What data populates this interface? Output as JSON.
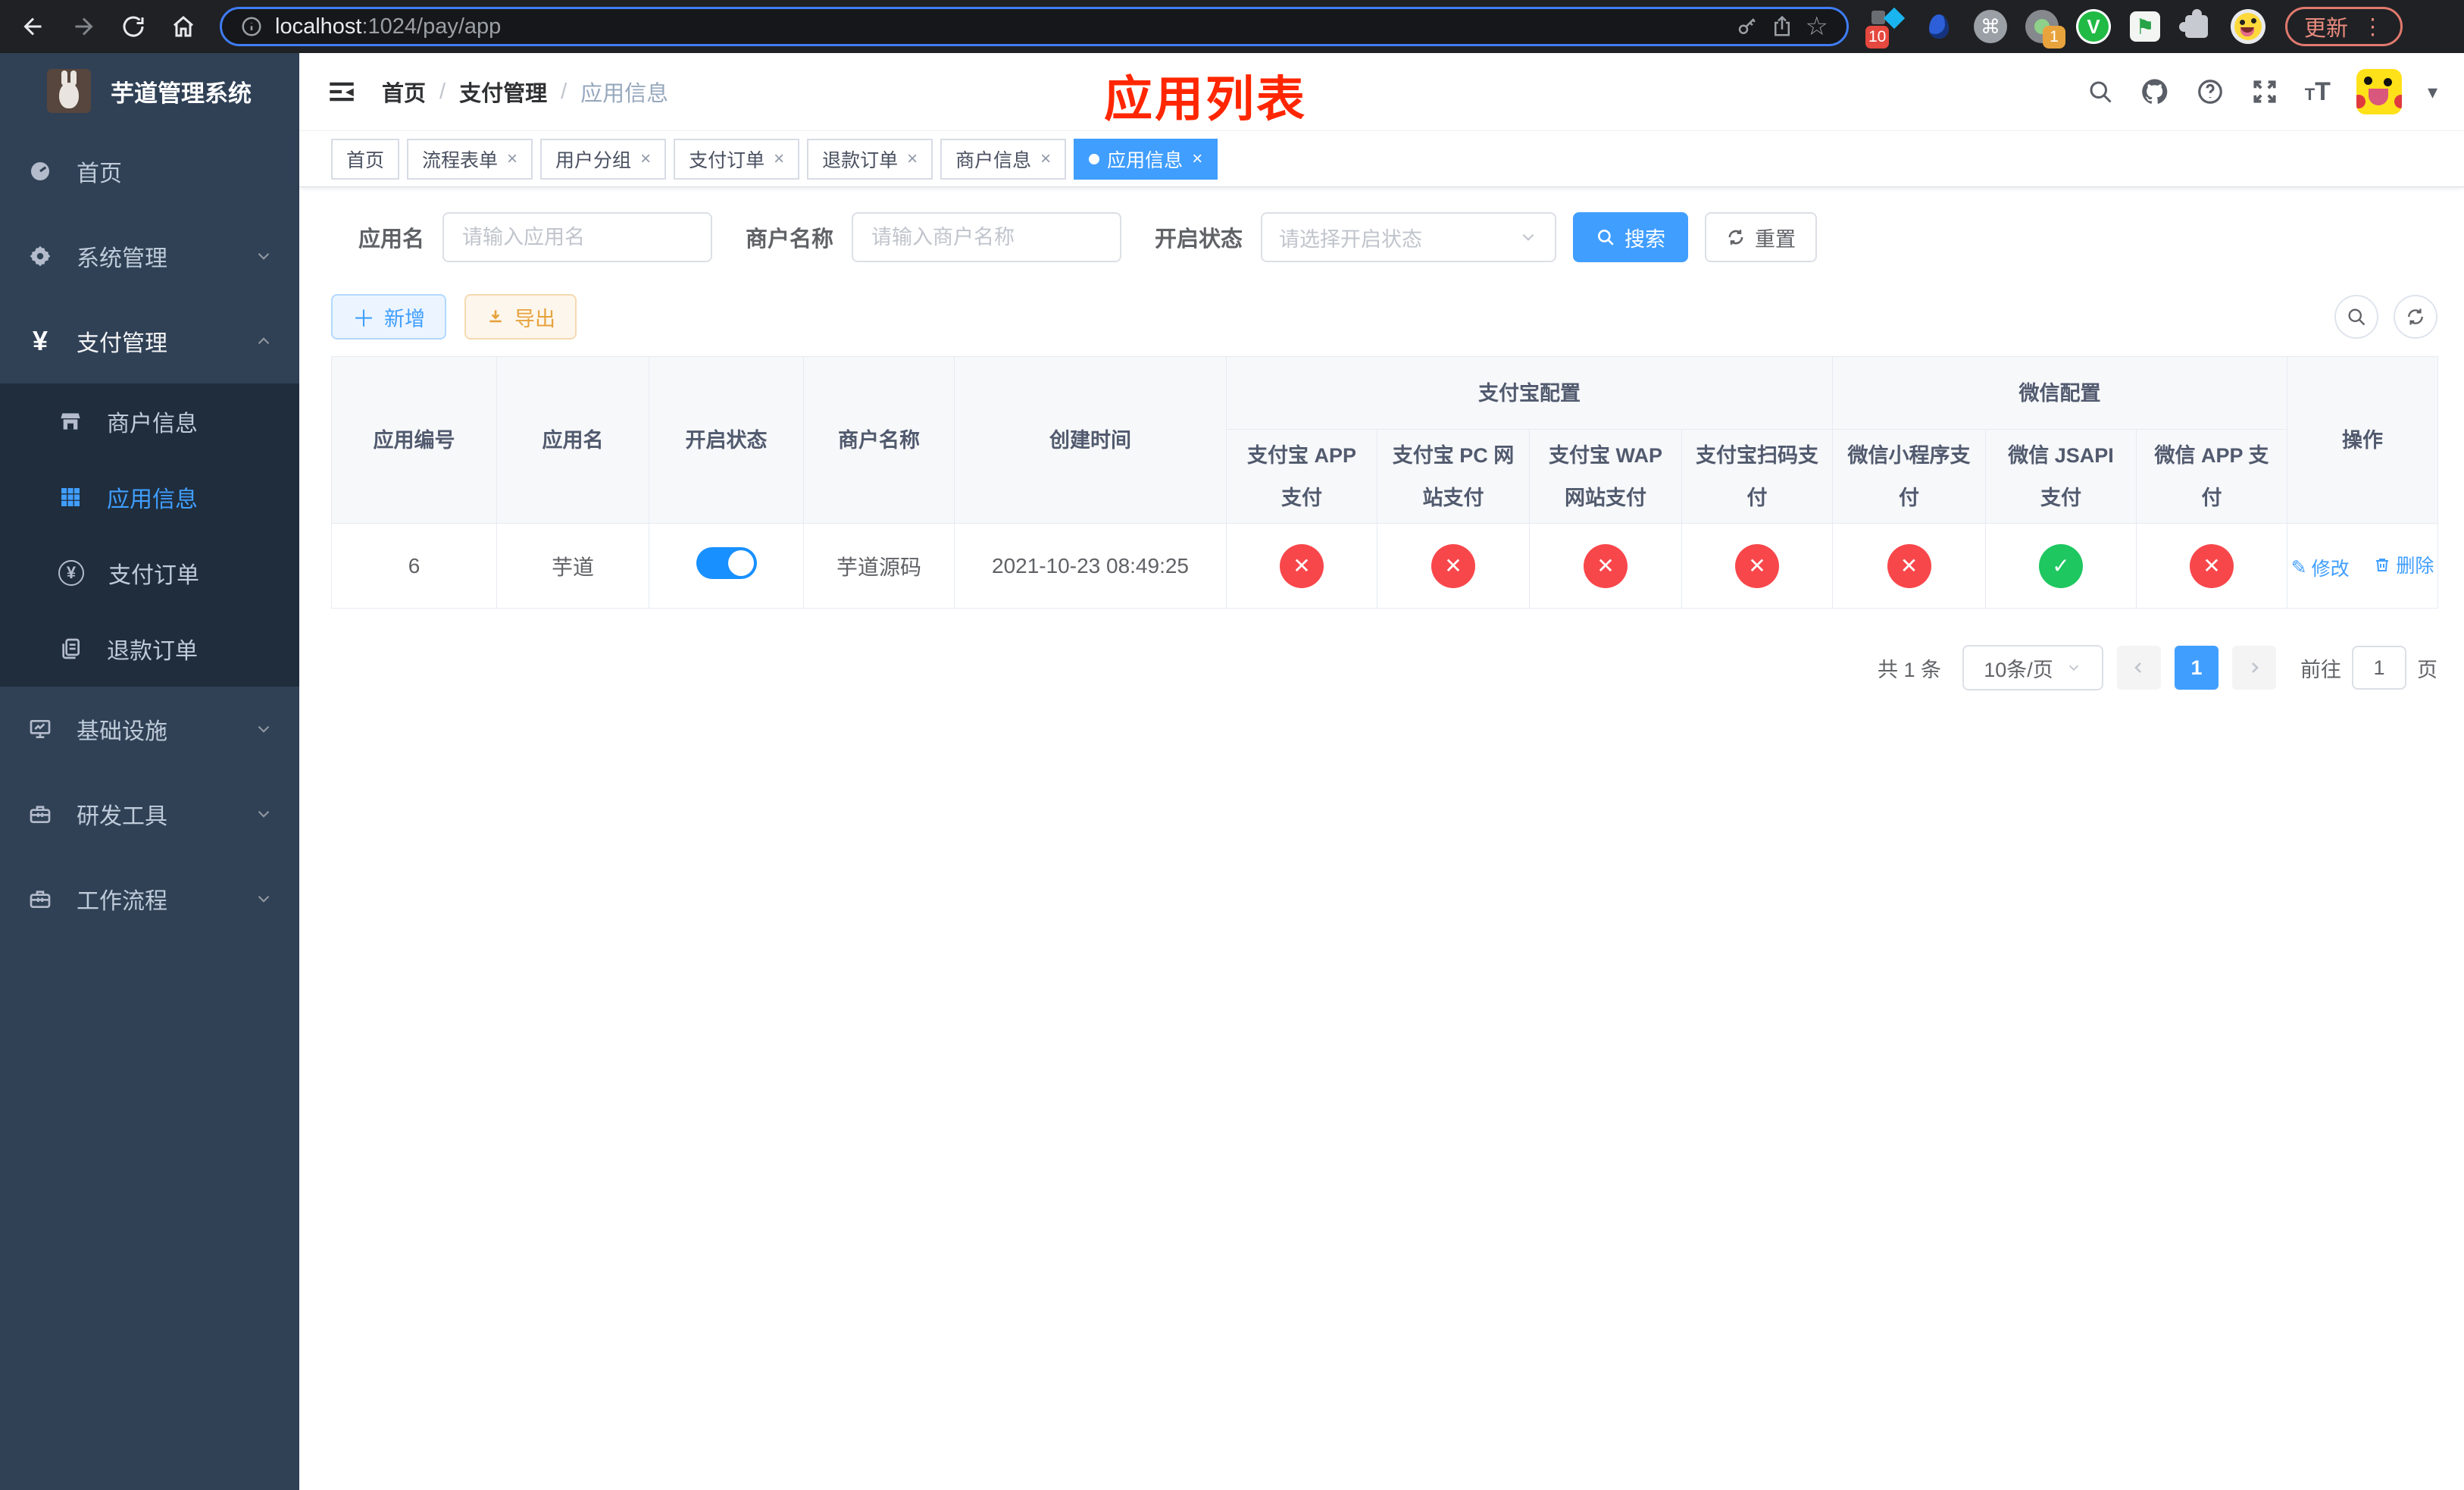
{
  "browser": {
    "url_host": "localhost",
    "url_path": ":1024/pay/app",
    "update_button": "更新",
    "badges": {
      "wappalyzer": "10",
      "recorder": "1"
    },
    "vue_devtools_label": "V",
    "flag_glyph": "⚑",
    "command_glyph": "⌘",
    "star_glyph": "☆",
    "kebab_glyph": "⋮"
  },
  "sidebar": {
    "title": "芋道管理系统",
    "menu": [
      {
        "label": "首页"
      },
      {
        "label": "系统管理"
      },
      {
        "label": "支付管理"
      },
      {
        "label": "基础设施"
      },
      {
        "label": "研发工具"
      },
      {
        "label": "工作流程"
      }
    ],
    "submenu": [
      {
        "label": "商户信息"
      },
      {
        "label": "应用信息"
      },
      {
        "label": "支付订单"
      },
      {
        "label": "退款订单"
      }
    ],
    "yen_glyph": "¥"
  },
  "header": {
    "breadcrumb": [
      "首页",
      "支付管理",
      "应用信息"
    ],
    "separator": "/",
    "annotation": "应用列表",
    "caret": "▾"
  },
  "tabs": [
    {
      "label": "首页",
      "closable": false,
      "active": false
    },
    {
      "label": "流程表单",
      "closable": true,
      "active": false
    },
    {
      "label": "用户分组",
      "closable": true,
      "active": false
    },
    {
      "label": "支付订单",
      "closable": true,
      "active": false
    },
    {
      "label": "退款订单",
      "closable": true,
      "active": false
    },
    {
      "label": "商户信息",
      "closable": true,
      "active": false
    },
    {
      "label": "应用信息",
      "closable": true,
      "active": true
    }
  ],
  "filters": {
    "app_name_label": "应用名",
    "app_name_placeholder": "请输入应用名",
    "merchant_label": "商户名称",
    "merchant_placeholder": "请输入商户名称",
    "status_label": "开启状态",
    "status_placeholder": "请选择开启状态",
    "search_button": "搜索",
    "reset_button": "重置"
  },
  "toolbar": {
    "add_button": "新增",
    "export_button": "导出",
    "plus_glyph": "＋"
  },
  "table": {
    "columns": {
      "app_id": "应用编号",
      "app_name": "应用名",
      "status": "开启状态",
      "merchant": "商户名称",
      "created": "创建时间",
      "alipay_group": "支付宝配置",
      "wechat_group": "微信配置",
      "alipay_app": "支付宝 APP 支付",
      "alipay_pc": "支付宝 PC 网站支付",
      "alipay_wap": "支付宝 WAP 网站支付",
      "alipay_qr": "支付宝扫码支付",
      "wx_lite": "微信小程序支付",
      "wx_jsapi": "微信 JSAPI 支付",
      "wx_app": "微信 APP 支付",
      "actions": "操作"
    },
    "row": {
      "app_id": "6",
      "app_name": "芋道",
      "status_on": true,
      "merchant": "芋道源码",
      "created": "2021-10-23 08:49:25",
      "alipay_app": "disabled",
      "alipay_pc": "disabled",
      "alipay_wap": "disabled",
      "alipay_qr": "disabled",
      "wx_lite": "disabled",
      "wx_jsapi": "enabled",
      "wx_app": "disabled"
    },
    "actions": {
      "edit": "修改",
      "delete": "删除"
    }
  },
  "pagination": {
    "total": "共 1 条",
    "page_size": "10条/页",
    "current_page": "1",
    "goto_prefix": "前往",
    "goto_value": "1",
    "goto_suffix": "页"
  },
  "icons": {
    "check": "✓",
    "cross": "✕",
    "close": "×",
    "pen": "✎"
  },
  "colors": {
    "primary": "#409eff",
    "success": "#1ec760",
    "danger": "#f8474b",
    "warning": "#e6a23c",
    "sidebar_bg": "#304156",
    "submenu_bg": "#1f2d3d",
    "annotation_red": "#ff2600",
    "toggle_on": "#1890ff"
  }
}
